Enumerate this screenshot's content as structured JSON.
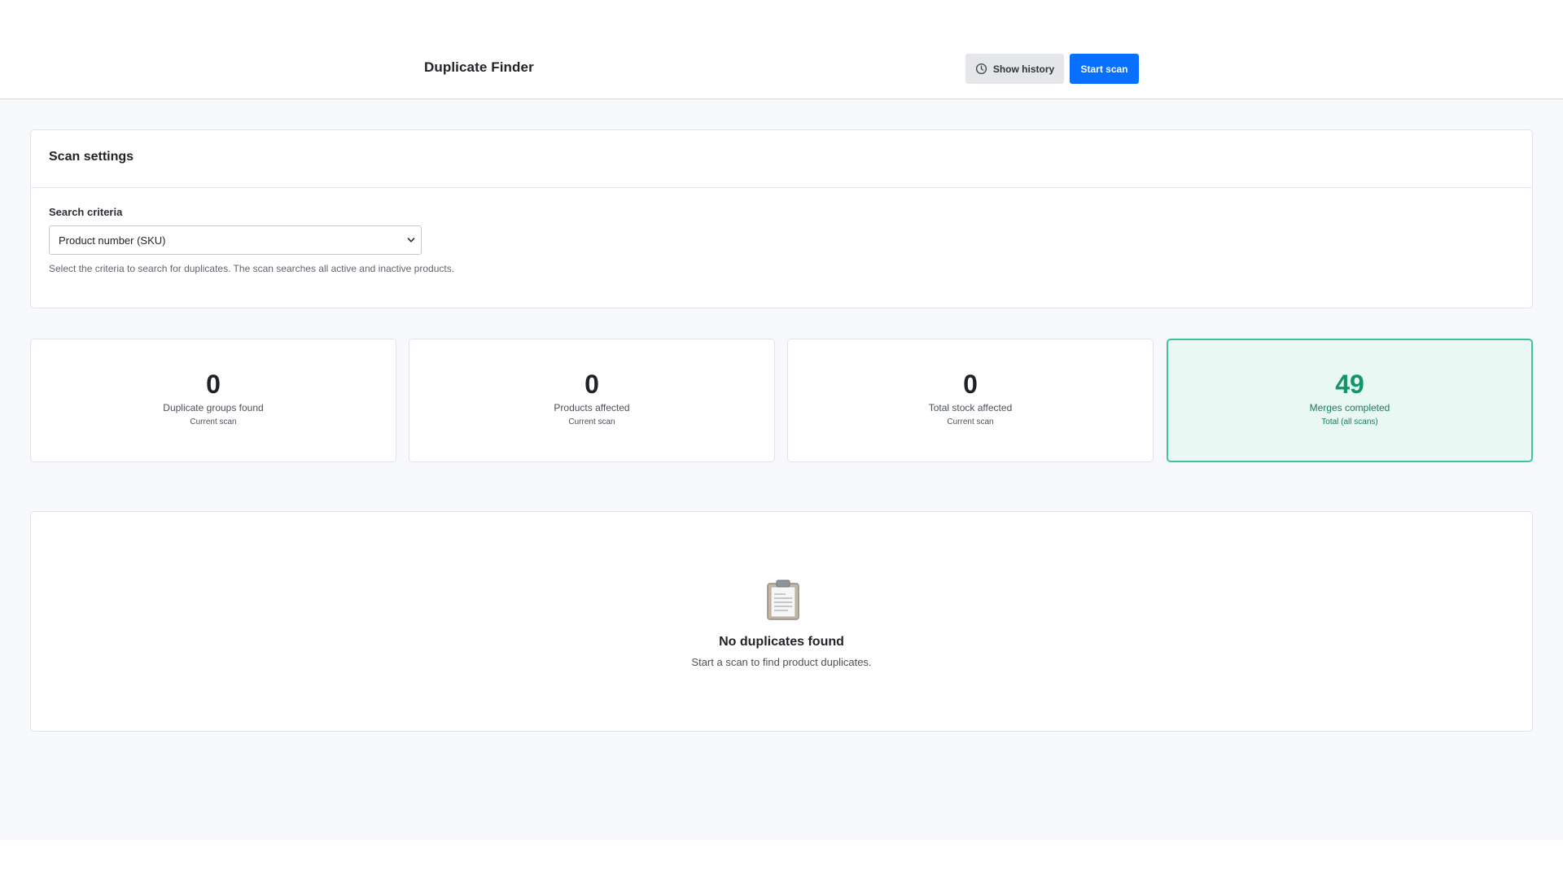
{
  "header": {
    "title": "Duplicate Finder",
    "show_history_label": "Show history",
    "start_scan_label": "Start scan"
  },
  "settings": {
    "title": "Scan settings",
    "criteria_label": "Search criteria",
    "criteria_value": "Product number (SKU)",
    "help_text": "Select the criteria to search for duplicates. The scan searches all active and inactive products."
  },
  "stats": [
    {
      "value": "0",
      "label": "Duplicate groups found",
      "sub": "Current scan"
    },
    {
      "value": "0",
      "label": "Products affected",
      "sub": "Current scan"
    },
    {
      "value": "0",
      "label": "Total stock affected",
      "sub": "Current scan"
    },
    {
      "value": "49",
      "label": "Merges completed",
      "sub": "Total (all scans)"
    }
  ],
  "empty_state": {
    "title": "No duplicates found",
    "subtitle": "Start a scan to find product duplicates."
  },
  "colors": {
    "primary": "#0870ff",
    "success": "#11966c",
    "success_bg": "#e9f8f2",
    "success_border": "#3fc39a"
  },
  "icons": {
    "history": "clock-icon",
    "select": "chevron-down-icon",
    "empty": "clipboard-icon"
  }
}
